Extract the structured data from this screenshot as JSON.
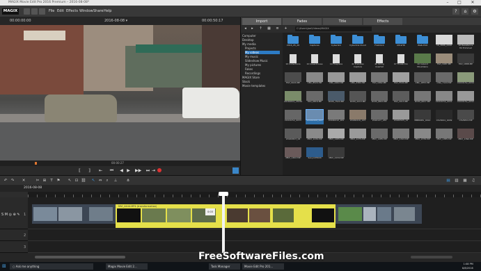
{
  "window": {
    "title": "MAGIX Movie Edit Pro 2016 Premium – 2016-08-08*",
    "controls": [
      "–",
      "□",
      "✕"
    ]
  },
  "menubar": {
    "logo": "MAGIX",
    "menus": [
      "File",
      "Edit",
      "Effects",
      "Window",
      "Share",
      "Help"
    ],
    "right_buttons": [
      "?",
      "⌂",
      "⚙"
    ]
  },
  "monitor": {
    "timecode_left": "00:00:00:00",
    "project_name": "2016-08-08 ▾",
    "timecode_right": "00:00:50:17",
    "scrub_time": "00:00:27",
    "transport": [
      "⟦",
      "⟧",
      "⇤",
      "⏮",
      "◀",
      "▶",
      "▶▶",
      "⏭",
      "⇥"
    ]
  },
  "pool": {
    "tabs": [
      "Import",
      "Fades",
      "Title",
      "Effects"
    ],
    "active_tab": "Import",
    "path": "C:\\Users\\Joe\\Videos\\MAGIX",
    "tree": [
      "Computer",
      "Desktop",
      "My media",
      "Projects",
      "My videos",
      "My music",
      "Slideshow Music",
      "My pictures",
      "Fakes",
      "Recordings",
      "MAGIX Store",
      "Stock",
      "Movie templates"
    ],
    "tree_selected": "My videos",
    "items": [
      {
        "name": "2016_05_26",
        "kind": "folder"
      },
      {
        "name": "Captures",
        "kind": "folder"
      },
      {
        "name": "Cyberlink",
        "kind": "folder"
      },
      {
        "name": "Cyberlink Cloud",
        "kind": "folder"
      },
      {
        "name": "FirstClick",
        "kind": "folder"
      },
      {
        "name": "UltraHD",
        "kind": "folder"
      },
      {
        "name": "Walk-Edit",
        "kind": "folder"
      },
      {
        "name": "10_3666_0006",
        "kind": "video",
        "color": "#d9d9d9"
      },
      {
        "name": "10 Resistence Hd Trimmed",
        "kind": "video",
        "color": "#bbbbbb"
      },
      {
        "name": "10 Collections",
        "kind": "file"
      },
      {
        "name": "10 Greenhouse",
        "kind": "file"
      },
      {
        "name": "10 Fireplace",
        "kind": "file"
      },
      {
        "name": "4k Preludes Capture",
        "kind": "file"
      },
      {
        "name": "4k String Quartet",
        "kind": "file"
      },
      {
        "name": "07 Finale.mlx",
        "kind": "file"
      },
      {
        "name": "10 Iceland Mountains",
        "kind": "video",
        "color": "#5a7a4a"
      },
      {
        "name": "MVI_3487.MP",
        "kind": "video",
        "color": "#9a8c7a"
      },
      {
        "name": "MVI_1888.MP",
        "kind": "video",
        "color": "#3a3a3a"
      },
      {
        "name": "MVI_0024.MP",
        "kind": "video",
        "color": "#4c4c4c"
      },
      {
        "name": "CBC_8524.MP",
        "kind": "video",
        "color": "#888"
      },
      {
        "name": "CBC_4462.MP",
        "kind": "video",
        "color": "#999"
      },
      {
        "name": "CBC_3382.MP",
        "kind": "video",
        "color": "#9a9a9a"
      },
      {
        "name": "MVI_1862.MP",
        "kind": "video",
        "color": "#777"
      },
      {
        "name": "MVI_5504.MP",
        "kind": "video",
        "color": "#a0a0a0"
      },
      {
        "name": "CBC_1855.MP",
        "kind": "video",
        "color": "#5a5a5a"
      },
      {
        "name": "CNA_7124.MP",
        "kind": "video",
        "color": "#6a6a6a"
      },
      {
        "name": "DOC0152_0030",
        "kind": "video",
        "color": "#8a9a7a"
      },
      {
        "name": "20160412_18150.MP",
        "kind": "video",
        "color": "#7a8c6a"
      },
      {
        "name": "MVI_0816.MP",
        "kind": "video",
        "color": "#6a6a6a"
      },
      {
        "name": "DCIM_7524.MP",
        "kind": "video",
        "color": "#4a5a6a"
      },
      {
        "name": "DCIM_2213.MP",
        "kind": "video",
        "color": "#555"
      },
      {
        "name": "DCIM_8824.MP",
        "kind": "video",
        "color": "#666"
      },
      {
        "name": "MVI_2013.MP",
        "kind": "video",
        "color": "#5c5c5c"
      },
      {
        "name": "DCIM_6617.MP",
        "kind": "video",
        "color": "#777"
      },
      {
        "name": "DOC0152_0031",
        "kind": "video",
        "color": "#888"
      },
      {
        "name": "DOC0152_0032",
        "kind": "video",
        "color": "#999"
      },
      {
        "name": "DOC0152_0033",
        "kind": "video",
        "color": "#666"
      },
      {
        "name": "20160408_163",
        "kind": "video",
        "color": "#6a8cb0",
        "selected": true
      },
      {
        "name": "20160412_181",
        "kind": "video",
        "color": "#7a7a7a"
      },
      {
        "name": "20160410_125",
        "kind": "video",
        "color": "#8a7a6a"
      },
      {
        "name": "2016127_183",
        "kind": "video",
        "color": "#6a6a6a"
      },
      {
        "name": "20160525_12",
        "kind": "video",
        "color": "#9a9a9a"
      },
      {
        "name": "BBB0081_0014",
        "kind": "video",
        "color": "#3a3a3a"
      },
      {
        "name": "CSV0001_0009",
        "kind": "video",
        "color": "#2a2a2a"
      },
      {
        "name": "CSV9824.MP",
        "kind": "video",
        "color": "#4a4a4a"
      },
      {
        "name": "20160823_06",
        "kind": "video",
        "color": "#5a5a5a"
      },
      {
        "name": "MKV_1234.MP",
        "kind": "video",
        "color": "#8a8a8a"
      },
      {
        "name": "MKV_1265.MP",
        "kind": "video",
        "color": "#aaa"
      },
      {
        "name": "MKV_1275.MP",
        "kind": "video",
        "color": "#9a9a9a"
      },
      {
        "name": "MKV_1285.MP",
        "kind": "video",
        "color": "#6a6a6a"
      },
      {
        "name": "MKV_1343.MP",
        "kind": "video",
        "color": "#7a7a7a"
      },
      {
        "name": "MKV_1376.MP",
        "kind": "video",
        "color": "#888"
      },
      {
        "name": "MKV_1385.MP",
        "kind": "video",
        "color": "#777"
      },
      {
        "name": "MKV_1390.MP",
        "kind": "video",
        "color": "#5a4a4a"
      },
      {
        "name": "MKV_1402.MP",
        "kind": "video",
        "color": "#6a5a5a"
      },
      {
        "name": "SanyoXH020",
        "kind": "video",
        "color": "#2d5c8c"
      },
      {
        "name": "MKV_2234.MP",
        "kind": "video",
        "color": "#3a3a3a"
      }
    ]
  },
  "timeline": {
    "project_tab": "2016-08-08",
    "clip_label": "MVI_4444.MP4 (transformation)",
    "tooltip": "0:03",
    "track_numbers": [
      "1",
      "2",
      "3"
    ],
    "track_flags": "S M ◎ ⊕ ✎"
  },
  "taskbar": {
    "search": "Ask me anything",
    "apps": [
      "Magix Movie Edit 2…",
      "Task Manager",
      "Movie Edit Pro 201…"
    ],
    "clock_time": "1:08 PM",
    "clock_date": "8/8/2016"
  },
  "watermark": "FreeSoftwareFiles.com"
}
